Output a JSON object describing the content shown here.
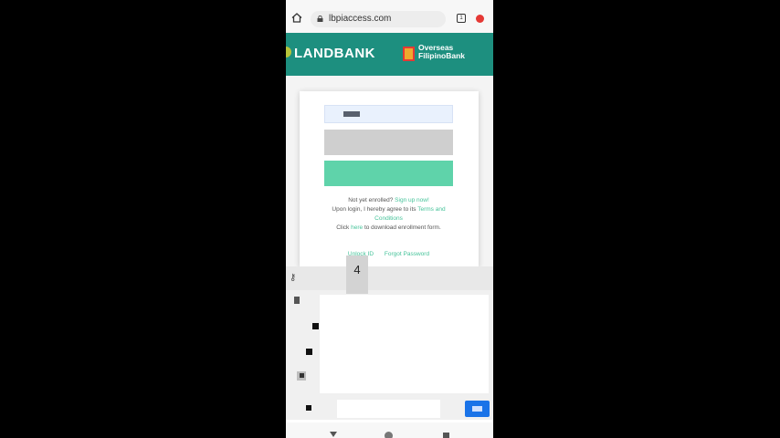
{
  "browser": {
    "url": "lbpiaccess.com",
    "tab_count": "1",
    "icons": [
      "home-icon",
      "lock-icon",
      "tabs-icon",
      "menu-icon"
    ]
  },
  "header": {
    "brand": "LANDBANK",
    "partner_line1": "Overseas",
    "partner_line2": "FilipinoBank",
    "color": "#1d8f7f"
  },
  "login": {
    "not_enrolled": "Not yet enrolled?",
    "sign_up": "Sign up now!",
    "agree_text": "Upon login, I hereby agree to its",
    "terms_line1": "Terms and",
    "terms_line2": "Conditions",
    "click": "Click",
    "here": "here",
    "download_text": "to download enrollment form.",
    "unlock_id": "Unlock ID",
    "forgot_password": "Forgot Password",
    "button_color": "#5fd3aa"
  },
  "keyboard": {
    "key_preview": "4"
  }
}
